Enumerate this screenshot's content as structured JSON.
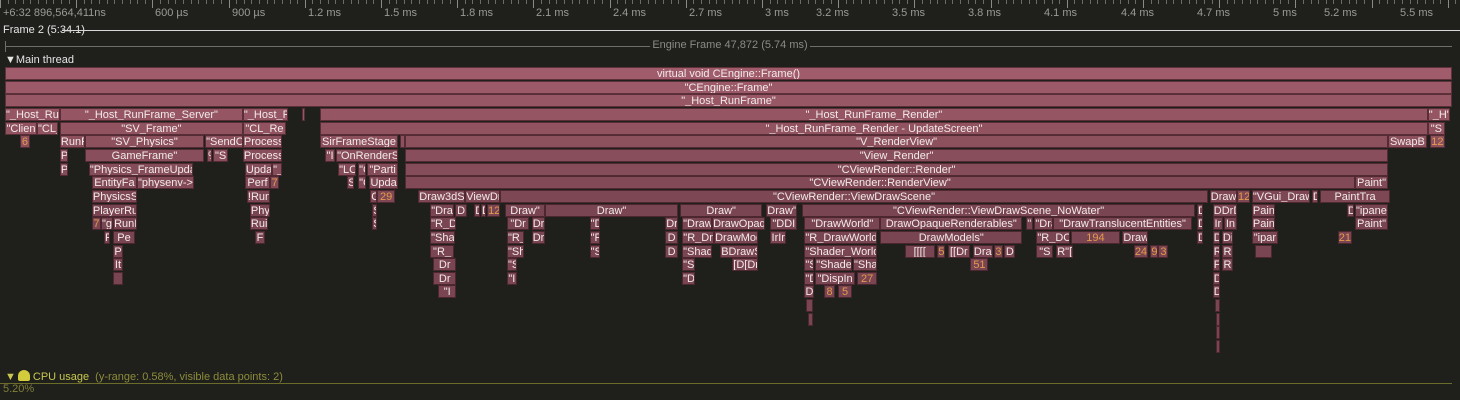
{
  "ruler": {
    "origin": "+6:32 896,564,411ns",
    "ticks": [
      {
        "label": "600 µs",
        "ms": 0.6
      },
      {
        "label": "900 µs",
        "ms": 0.9
      },
      {
        "label": "1.2 ms",
        "ms": 1.2
      },
      {
        "label": "1.5 ms",
        "ms": 1.5
      },
      {
        "label": "1.8 ms",
        "ms": 1.8
      },
      {
        "label": "2.1 ms",
        "ms": 2.1
      },
      {
        "label": "2.4 ms",
        "ms": 2.4
      },
      {
        "label": "2.7 ms",
        "ms": 2.7
      },
      {
        "label": "3 ms",
        "ms": 3.0
      },
      {
        "label": "3.2 ms",
        "ms": 3.2
      },
      {
        "label": "3.5 ms",
        "ms": 3.5
      },
      {
        "label": "3.8 ms",
        "ms": 3.8
      },
      {
        "label": "4.1 ms",
        "ms": 4.1
      },
      {
        "label": "4.4 ms",
        "ms": 4.4
      },
      {
        "label": "4.7 ms",
        "ms": 4.7
      },
      {
        "label": "5 ms",
        "ms": 5.0
      },
      {
        "label": "5.2 ms",
        "ms": 5.2
      },
      {
        "label": "5.5 ms",
        "ms": 5.5
      }
    ]
  },
  "frame": {
    "label": "Frame 2 (5:34.1)"
  },
  "engine_frame": {
    "label": "Engine Frame 47,872 (5.74 ms)"
  },
  "thread": {
    "label": "▼Main thread"
  },
  "cpu": {
    "label": "CPU usage",
    "arrow": "▼",
    "extra": "(y-range: 0.58%, visible data points: 2)",
    "value": "5.20%"
  },
  "colors": {
    "zone_top": "#a05c6a",
    "zone_deep": "#7a4552",
    "count_text": "#e49a4a",
    "background": "#1f1f1b"
  },
  "zones": [
    {
      "l": "virtual void CEngine::Frame()",
      "s": 0,
      "e": 5742,
      "d": 0
    },
    {
      "l": "\"CEngine::Frame\"",
      "s": 0,
      "e": 5742,
      "d": 1
    },
    {
      "l": "\"_Host_RunFrame\"",
      "s": 0,
      "e": 5742,
      "d": 2
    },
    {
      "l": "\"_Host_Ru",
      "s": 0,
      "e": 218,
      "d": 3
    },
    {
      "l": "\"_Host_RunFrame_Server\"",
      "s": 218,
      "e": 944,
      "d": 3
    },
    {
      "l": "\"_Host_F",
      "s": 944,
      "e": 1123,
      "d": 3
    },
    {
      "l": "",
      "s": 1179,
      "e": 1191,
      "d": 3
    },
    {
      "l": "\"_Host_RunFrame_Render\"",
      "s": 1250,
      "e": 5646,
      "d": 3
    },
    {
      "l": "\"_H\"",
      "s": 5646,
      "e": 5734,
      "d": 3
    },
    {
      "l": "\"Clien",
      "s": 0,
      "e": 127,
      "d": 4
    },
    {
      "l": "\"CL_",
      "s": 127,
      "e": 210,
      "d": 4
    },
    {
      "l": "\"SV_Frame\"",
      "s": 218,
      "e": 944,
      "d": 4
    },
    {
      "l": "\"CL_Re",
      "s": 944,
      "e": 1115,
      "d": 4
    },
    {
      "l": "\"_Host_RunFrame_Render - UpdateScreen\"",
      "s": 1250,
      "e": 5646,
      "d": 4
    },
    {
      "l": "\"S",
      "s": 5646,
      "e": 5714,
      "d": 4
    },
    {
      "l": "6",
      "s": 60,
      "e": 99,
      "d": 5,
      "c": true
    },
    {
      "l": "RunF",
      "s": 218,
      "e": 317,
      "d": 5
    },
    {
      "l": "\"SV_Physics\"",
      "s": 317,
      "e": 790,
      "d": 5
    },
    {
      "l": "\"SendC",
      "s": 794,
      "e": 944,
      "d": 5
    },
    {
      "l": "Process",
      "s": 944,
      "e": 1099,
      "d": 5
    },
    {
      "l": "SirFrameStage",
      "s": 1250,
      "e": 1560,
      "d": 5
    },
    {
      "l": "",
      "s": 1566,
      "e": 1586,
      "d": 5
    },
    {
      "l": "\"V_RenderView\"",
      "s": 1588,
      "e": 5488,
      "d": 5
    },
    {
      "l": "SwapB",
      "s": 5488,
      "e": 5642,
      "d": 5
    },
    {
      "l": "12",
      "s": 5654,
      "e": 5714,
      "d": 5,
      "c": true
    },
    {
      "l": "P",
      "s": 218,
      "e": 250,
      "d": 6
    },
    {
      "l": "GameFrame\"",
      "s": 317,
      "e": 790,
      "d": 6
    },
    {
      "l": "%",
      "s": 802,
      "e": 822,
      "d": 6
    },
    {
      "l": "\"S",
      "s": 826,
      "e": 885,
      "d": 6
    },
    {
      "l": "Process",
      "s": 944,
      "e": 1099,
      "d": 6
    },
    {
      "l": "\"I",
      "s": 1270,
      "e": 1310,
      "d": 6
    },
    {
      "l": "\"OnRenderS",
      "s": 1314,
      "e": 1560,
      "d": 6
    },
    {
      "l": "\"View_Render\"",
      "s": 1588,
      "e": 5488,
      "d": 6
    },
    {
      "l": "P",
      "s": 218,
      "e": 250,
      "d": 7
    },
    {
      "l": "\"Physics_FrameUpda",
      "s": 333,
      "e": 746,
      "d": 7
    },
    {
      "l": "Upda",
      "s": 952,
      "e": 1060,
      "d": 7
    },
    {
      "l": "\"_",
      "s": 1060,
      "e": 1099,
      "d": 7
    },
    {
      "l": "\"LC",
      "s": 1322,
      "e": 1393,
      "d": 7
    },
    {
      "l": "\"C",
      "s": 1401,
      "e": 1433,
      "d": 7
    },
    {
      "l": "\"Parti",
      "s": 1437,
      "e": 1560,
      "d": 7
    },
    {
      "l": "\"CViewRender::Render\"",
      "s": 1588,
      "e": 5488,
      "d": 7
    },
    {
      "l": "EntityFa",
      "s": 345,
      "e": 524,
      "d": 8
    },
    {
      "l": "\"physenv->",
      "s": 524,
      "e": 750,
      "d": 8
    },
    {
      "l": "Perf",
      "s": 952,
      "e": 1052,
      "d": 8
    },
    {
      "l": "7",
      "s": 1052,
      "e": 1088,
      "d": 8,
      "c": true
    },
    {
      "l": "S",
      "s": 1358,
      "e": 1385,
      "d": 8
    },
    {
      "l": "\"C",
      "s": 1401,
      "e": 1433,
      "d": 8
    },
    {
      "l": "Upda",
      "s": 1445,
      "e": 1560,
      "d": 8
    },
    {
      "l": "\"CViewRender::RenderView\"",
      "s": 1588,
      "e": 5357,
      "d": 8
    },
    {
      "l": "Paint\"",
      "s": 5357,
      "e": 5488,
      "d": 8
    },
    {
      "l": "PhysicsS",
      "s": 345,
      "e": 524,
      "d": 9
    },
    {
      "l": "!Run",
      "s": 960,
      "e": 1052,
      "d": 9
    },
    {
      "l": "C",
      "s": 1449,
      "e": 1477,
      "d": 9
    },
    {
      "l": "29",
      "s": 1477,
      "e": 1548,
      "d": 9,
      "c": true
    },
    {
      "l": "Draw3dS",
      "s": 1640,
      "e": 1826,
      "d": 9
    },
    {
      "l": "ViewDr",
      "s": 1826,
      "e": 1965,
      "d": 9
    },
    {
      "l": "\"CViewRender::ViewDrawScene\"",
      "s": 1965,
      "e": 4773,
      "d": 9
    },
    {
      "l": "Draw",
      "s": 4781,
      "e": 4889,
      "d": 9
    },
    {
      "l": "12",
      "s": 4889,
      "e": 4940,
      "d": 9,
      "c": true
    },
    {
      "l": "\"VGui_DrawHud\"",
      "s": 4948,
      "e": 5178,
      "d": 9
    },
    {
      "l": "D",
      "s": 5186,
      "e": 5210,
      "d": 9
    },
    {
      "l": "PaintTra",
      "s": 5218,
      "e": 5496,
      "d": 9
    },
    {
      "l": "PlayerRu",
      "s": 345,
      "e": 524,
      "d": 10
    },
    {
      "l": "Phy",
      "s": 972,
      "e": 1052,
      "d": 10
    },
    {
      "l": "S",
      "s": 1457,
      "e": 1477,
      "d": 10
    },
    {
      "l": "\"Dra",
      "s": 1687,
      "e": 1782,
      "d": 10
    },
    {
      "l": "D",
      "s": 1786,
      "e": 1834,
      "d": 10
    },
    {
      "l": "D",
      "s": 1862,
      "e": 1886,
      "d": 10
    },
    {
      "l": "D",
      "s": 1889,
      "e": 1909,
      "d": 10
    },
    {
      "l": "12",
      "s": 1913,
      "e": 1965,
      "d": 10,
      "c": true
    },
    {
      "l": "Draw\"",
      "s": 1984,
      "e": 2143,
      "d": 10
    },
    {
      "l": "Draw\"",
      "s": 2143,
      "e": 2671,
      "d": 10
    },
    {
      "l": "Draw\"",
      "s": 2679,
      "e": 3005,
      "d": 10
    },
    {
      "l": "Draw\"",
      "s": 3021,
      "e": 3144,
      "d": 10
    },
    {
      "l": "\"CViewRender::ViewDrawScene_NoWater\"",
      "s": 3164,
      "e": 4722,
      "d": 10
    },
    {
      "l": "D",
      "s": 4730,
      "e": 4754,
      "d": 10
    },
    {
      "l": "DDrD",
      "s": 4793,
      "e": 4889,
      "d": 10
    },
    {
      "l": "Paint'",
      "s": 4948,
      "e": 5039,
      "d": 10
    },
    {
      "l": "D",
      "s": 5325,
      "e": 5353,
      "d": 10
    },
    {
      "l": "\"ipanelP",
      "s": 5357,
      "e": 5488,
      "d": 10
    },
    {
      "l": "7",
      "s": 345,
      "e": 381,
      "d": 11,
      "c": true
    },
    {
      "l": "\"g",
      "s": 381,
      "e": 429,
      "d": 11
    },
    {
      "l": "RunI",
      "s": 429,
      "e": 524,
      "d": 11
    },
    {
      "l": "Rui",
      "s": 972,
      "e": 1044,
      "d": 11
    },
    {
      "l": "S",
      "s": 1457,
      "e": 1477,
      "d": 11
    },
    {
      "l": "\"R_D",
      "s": 1687,
      "e": 1790,
      "d": 11
    },
    {
      "l": "\"Dr",
      "s": 1992,
      "e": 2080,
      "d": 11
    },
    {
      "l": "Dr",
      "s": 2090,
      "e": 2143,
      "d": 11
    },
    {
      "l": "\"D",
      "s": 2320,
      "e": 2360,
      "d": 11
    },
    {
      "l": "Dr",
      "s": 2620,
      "e": 2671,
      "d": 11
    },
    {
      "l": "\"Draw",
      "s": 2687,
      "e": 2806,
      "d": 11
    },
    {
      "l": "DrawOpaq",
      "s": 2806,
      "e": 3017,
      "d": 11
    },
    {
      "l": "\"DDI",
      "s": 3037,
      "e": 3144,
      "d": 11
    },
    {
      "l": "\"DrawWorld\"",
      "s": 3172,
      "e": 3473,
      "d": 11
    },
    {
      "l": "DrawOpaqueRenderables\"",
      "s": 3473,
      "e": 4037,
      "d": 11
    },
    {
      "l": "\"I",
      "s": 4053,
      "e": 4081,
      "d": 11
    },
    {
      "l": "\"Draw",
      "s": 4085,
      "e": 4160,
      "d": 11
    },
    {
      "l": "\"DrawTranslucentEntities\"",
      "s": 4160,
      "e": 4710,
      "d": 11
    },
    {
      "l": "D",
      "s": 4730,
      "e": 4754,
      "d": 11
    },
    {
      "l": "Ir",
      "s": 4793,
      "e": 4833,
      "d": 11
    },
    {
      "l": "In",
      "s": 4837,
      "e": 4889,
      "d": 11
    },
    {
      "l": "Paint",
      "s": 4948,
      "e": 5039,
      "d": 11
    },
    {
      "l": "Paint\"",
      "s": 5357,
      "e": 5488,
      "d": 11
    },
    {
      "l": "F",
      "s": 393,
      "e": 417,
      "d": 12
    },
    {
      "l": "Pe",
      "s": 429,
      "e": 516,
      "d": 12
    },
    {
      "l": "F",
      "s": 992,
      "e": 1032,
      "d": 12
    },
    {
      "l": "\"Sha",
      "s": 1687,
      "e": 1786,
      "d": 12
    },
    {
      "l": "\"R_",
      "s": 1992,
      "e": 2060,
      "d": 12
    },
    {
      "l": "Dr",
      "s": 2090,
      "e": 2143,
      "d": 12
    },
    {
      "l": "\"R",
      "s": 2320,
      "e": 2360,
      "d": 12
    },
    {
      "l": "D",
      "s": 2620,
      "e": 2671,
      "d": 12
    },
    {
      "l": "\"R_Dr",
      "s": 2687,
      "e": 2814,
      "d": 12
    },
    {
      "l": "DrawMod",
      "s": 2814,
      "e": 2989,
      "d": 12
    },
    {
      "l": "IrIr",
      "s": 3037,
      "e": 3100,
      "d": 12
    },
    {
      "l": "\"R_DrawWorld",
      "s": 3172,
      "e": 3461,
      "d": 12
    },
    {
      "l": "DrawModels\"",
      "s": 3473,
      "e": 4037,
      "d": 12
    },
    {
      "l": "\"R_DC",
      "s": 4093,
      "e": 4228,
      "d": 12
    },
    {
      "l": "194",
      "s": 4228,
      "e": 4426,
      "d": 12,
      "c": true
    },
    {
      "l": "DrawM",
      "s": 4434,
      "e": 4537,
      "d": 12
    },
    {
      "l": "D",
      "s": 4730,
      "e": 4754,
      "d": 12
    },
    {
      "l": "D",
      "s": 4793,
      "e": 4821,
      "d": 12
    },
    {
      "l": "Di",
      "s": 4829,
      "e": 4873,
      "d": 12
    },
    {
      "l": "\"ipar",
      "s": 4948,
      "e": 5051,
      "d": 12
    },
    {
      "l": "21",
      "s": 5289,
      "e": 5345,
      "d": 12,
      "c": true
    },
    {
      "l": "P",
      "s": 429,
      "e": 468,
      "d": 13
    },
    {
      "l": "\"R_",
      "s": 1687,
      "e": 1782,
      "d": 13
    },
    {
      "l": "\"Sh",
      "s": 1992,
      "e": 2060,
      "d": 13
    },
    {
      "l": "\"S",
      "s": 2320,
      "e": 2360,
      "d": 13
    },
    {
      "l": "D",
      "s": 2620,
      "e": 2671,
      "d": 13
    },
    {
      "l": "\"Shad",
      "s": 2687,
      "e": 2806,
      "d": 13
    },
    {
      "l": "BDrawS",
      "s": 2838,
      "e": 2989,
      "d": 13
    },
    {
      "l": "\"Shader_World",
      "s": 3172,
      "e": 3461,
      "d": 13
    },
    {
      "l": "[[[[",
      "s": 3570,
      "e": 3690,
      "d": 13
    },
    {
      "l": "5",
      "s": 3700,
      "e": 3732,
      "d": 13,
      "c": true
    },
    {
      "l": "[[Dr",
      "s": 3740,
      "e": 3830,
      "d": 13
    },
    {
      "l": "Dra",
      "s": 3840,
      "e": 3920,
      "d": 13
    },
    {
      "l": "3",
      "s": 3925,
      "e": 3960,
      "d": 13,
      "c": true
    },
    {
      "l": "D",
      "s": 3965,
      "e": 4010,
      "d": 13
    },
    {
      "l": "\"S",
      "s": 4093,
      "e": 4160,
      "d": 13
    },
    {
      "l": "R\"[",
      "s": 4170,
      "e": 4240,
      "d": 13
    },
    {
      "l": "24",
      "s": 4478,
      "e": 4537,
      "d": 13,
      "c": true
    },
    {
      "l": "9",
      "s": 4545,
      "e": 4577,
      "d": 13,
      "c": true
    },
    {
      "l": "3",
      "s": 4577,
      "e": 4617,
      "d": 13,
      "c": true
    },
    {
      "l": "R",
      "s": 4793,
      "e": 4821,
      "d": 13
    },
    {
      "l": "R",
      "s": 4829,
      "e": 4873,
      "d": 13
    },
    {
      "l": "",
      "s": 4960,
      "e": 5030,
      "d": 13
    },
    {
      "l": "It",
      "s": 429,
      "e": 468,
      "d": 14
    },
    {
      "l": "Dr",
      "s": 1700,
      "e": 1790,
      "d": 14
    },
    {
      "l": "\"S",
      "s": 1992,
      "e": 2030,
      "d": 14
    },
    {
      "l": "\"S",
      "s": 2687,
      "e": 2739,
      "d": 14
    },
    {
      "l": "[D[Dr",
      "s": 2886,
      "e": 2989,
      "d": 14
    },
    {
      "l": "\"S",
      "s": 3172,
      "e": 3212,
      "d": 14
    },
    {
      "l": "\"Shade",
      "s": 3215,
      "e": 3361,
      "d": 14
    },
    {
      "l": "\"Sha",
      "s": 3365,
      "e": 3461,
      "d": 14
    },
    {
      "l": "51",
      "s": 3831,
      "e": 3903,
      "d": 14,
      "c": true
    },
    {
      "l": "F",
      "s": 4793,
      "e": 4821,
      "d": 14
    },
    {
      "l": "R",
      "s": 4829,
      "e": 4873,
      "d": 14
    },
    {
      "l": "",
      "s": 429,
      "e": 468,
      "d": 15
    },
    {
      "l": "Dr",
      "s": 1700,
      "e": 1790,
      "d": 15
    },
    {
      "l": "\"I",
      "s": 1992,
      "e": 2030,
      "d": 15
    },
    {
      "l": "\"D",
      "s": 2687,
      "e": 2739,
      "d": 15
    },
    {
      "l": "\"D",
      "s": 3172,
      "e": 3212,
      "d": 15
    },
    {
      "l": "\"DispIn",
      "s": 3215,
      "e": 3373,
      "d": 15
    },
    {
      "l": "27",
      "s": 3381,
      "e": 3461,
      "d": 15,
      "c": true
    },
    {
      "l": "D",
      "s": 4793,
      "e": 4821,
      "d": 15
    },
    {
      "l": "\"I",
      "s": 1720,
      "e": 1790,
      "d": 16
    },
    {
      "l": "D",
      "s": 3172,
      "e": 3212,
      "d": 16
    },
    {
      "l": "8",
      "s": 3250,
      "e": 3294,
      "d": 16,
      "c": true
    },
    {
      "l": "5",
      "s": 3306,
      "e": 3361,
      "d": 16,
      "c": true
    },
    {
      "l": "D",
      "s": 4793,
      "e": 4821,
      "d": 16
    },
    {
      "l": "",
      "s": 3180,
      "e": 3205,
      "d": 17
    },
    {
      "l": "",
      "s": 4800,
      "e": 4821,
      "d": 17
    },
    {
      "l": "",
      "s": 3185,
      "e": 3205,
      "d": 18
    },
    {
      "l": "",
      "s": 4805,
      "e": 4821,
      "d": 18
    },
    {
      "l": "",
      "s": 4805,
      "e": 4821,
      "d": 19
    },
    {
      "l": "",
      "s": 4805,
      "e": 4821,
      "d": 20
    }
  ]
}
